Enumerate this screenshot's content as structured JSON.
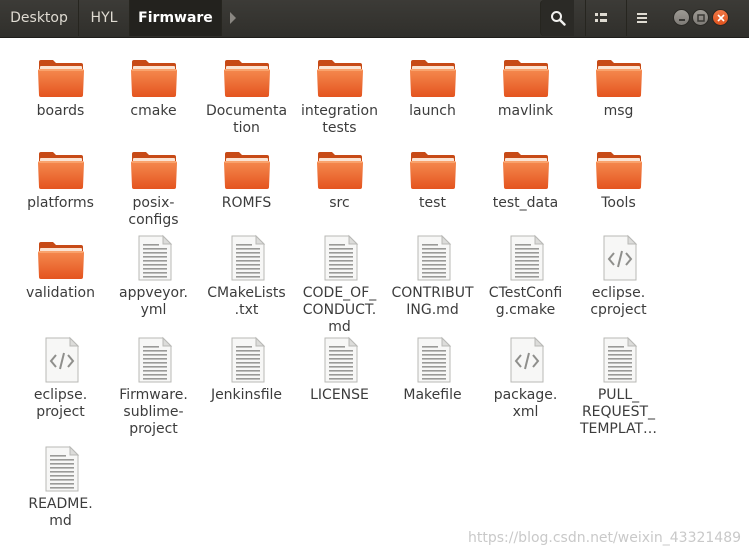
{
  "header": {
    "breadcrumbs": [
      {
        "label": "Desktop"
      },
      {
        "label": "HYL"
      },
      {
        "label": "Firmware",
        "active": true
      }
    ]
  },
  "colors": {
    "folder_top": "#f9a26c",
    "folder_body": "#e95420",
    "headerbar": "#3c3b37",
    "close_button": "#e95420"
  },
  "icons": {
    "search": "search-icon",
    "view": "grid-view-icon",
    "menu": "hamburger-menu-icon",
    "minimize": "minimize-icon",
    "maximize": "maximize-icon",
    "close": "close-icon",
    "next": "chevron-right-icon"
  },
  "files": [
    {
      "label": "boards",
      "type": "folder"
    },
    {
      "label": "cmake",
      "type": "folder"
    },
    {
      "label": "Documenta\ntion",
      "type": "folder"
    },
    {
      "label": "integration\ntests",
      "type": "folder"
    },
    {
      "label": "launch",
      "type": "folder"
    },
    {
      "label": "mavlink",
      "type": "folder"
    },
    {
      "label": "msg",
      "type": "folder"
    },
    {
      "label": "platforms",
      "type": "folder"
    },
    {
      "label": "posix-\nconfigs",
      "type": "folder"
    },
    {
      "label": "ROMFS",
      "type": "folder"
    },
    {
      "label": "src",
      "type": "folder"
    },
    {
      "label": "test",
      "type": "folder"
    },
    {
      "label": "test_data",
      "type": "folder"
    },
    {
      "label": "Tools",
      "type": "folder"
    },
    {
      "label": "validation",
      "type": "folder"
    },
    {
      "label": "appveyor.\nyml",
      "type": "text"
    },
    {
      "label": "CMakeLists\n.txt",
      "type": "text"
    },
    {
      "label": "CODE_OF_\nCONDUCT.\nmd",
      "type": "text"
    },
    {
      "label": "CONTRIBUT\nING.md",
      "type": "text"
    },
    {
      "label": "CTestConfi\ng.cmake",
      "type": "text"
    },
    {
      "label": "eclipse.\ncproject",
      "type": "xml"
    },
    {
      "label": "eclipse.\nproject",
      "type": "xml"
    },
    {
      "label": "Firmware.\nsublime-\nproject",
      "type": "text"
    },
    {
      "label": "Jenkinsfile",
      "type": "text"
    },
    {
      "label": "LICENSE",
      "type": "text"
    },
    {
      "label": "Makefile",
      "type": "text"
    },
    {
      "label": "package.\nxml",
      "type": "xml"
    },
    {
      "label": "PULL_\nREQUEST_\nTEMPLAT…",
      "type": "text"
    },
    {
      "label": "README.\nmd",
      "type": "text"
    }
  ],
  "watermark": "https://blog.csdn.net/weixin_43321489"
}
